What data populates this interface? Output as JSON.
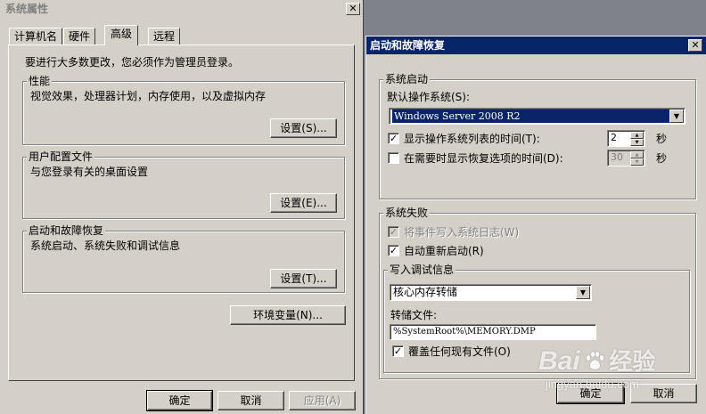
{
  "sys_window": {
    "title": "系统属性",
    "close_glyph": "✕",
    "tabs": [
      {
        "label": "计算机名"
      },
      {
        "label": "硬件"
      },
      {
        "label": "高级"
      },
      {
        "label": "远程"
      }
    ],
    "admin_notice": "要进行大多数更改，您必须作为管理员登录。",
    "performance": {
      "label": "性能",
      "desc": "视觉效果，处理器计划，内存使用，以及虚拟内存",
      "button": "设置(S)..."
    },
    "user_profile": {
      "label": "用户配置文件",
      "desc": "与您登录有关的桌面设置",
      "button": "设置(E)..."
    },
    "startup_recovery": {
      "label": "启动和故障恢复",
      "desc": "系统启动、系统失败和调试信息",
      "button": "设置(T)..."
    },
    "env_button": "环境变量(N)...",
    "ok": "确定",
    "cancel": "取消",
    "apply": "应用(A)"
  },
  "dialog": {
    "title": "启动和故障恢复",
    "close_glyph": "✕",
    "startup": {
      "label": "系统启动",
      "default_os_label": "默认操作系统(S):",
      "default_os_value": "Windows Server 2008 R2",
      "show_list_label": "显示操作系统列表的时间(T):",
      "show_list_checked": true,
      "show_list_value": "2",
      "show_recovery_label": "在需要时显示恢复选项的时间(D):",
      "show_recovery_checked": false,
      "show_recovery_value": "30",
      "seconds": "秒"
    },
    "failure": {
      "label": "系统失败",
      "write_event_label": "将事件写入系统日志(W)",
      "write_event_checked": true,
      "write_event_disabled": true,
      "auto_restart_label": "自动重新启动(R)",
      "auto_restart_checked": true,
      "debug": {
        "label": "写入调试信息",
        "dump_type": "核心内存转储",
        "dump_file_label": "转储文件:",
        "dump_file_value": "%SystemRoot%\\MEMORY.DMP",
        "overwrite_label": "覆盖任何现有文件(O)",
        "overwrite_checked": true
      }
    },
    "ok": "确定",
    "cancel": "取消"
  },
  "watermark": {
    "brand": "Bai",
    "brand_icon": "paw-icon",
    "brand_suffix": "经验",
    "url": "jingyan.baidu.com"
  },
  "colors": {
    "window_bg": "#d4d0c8",
    "active_title": "#0a246a",
    "selection": "#0a246a"
  }
}
